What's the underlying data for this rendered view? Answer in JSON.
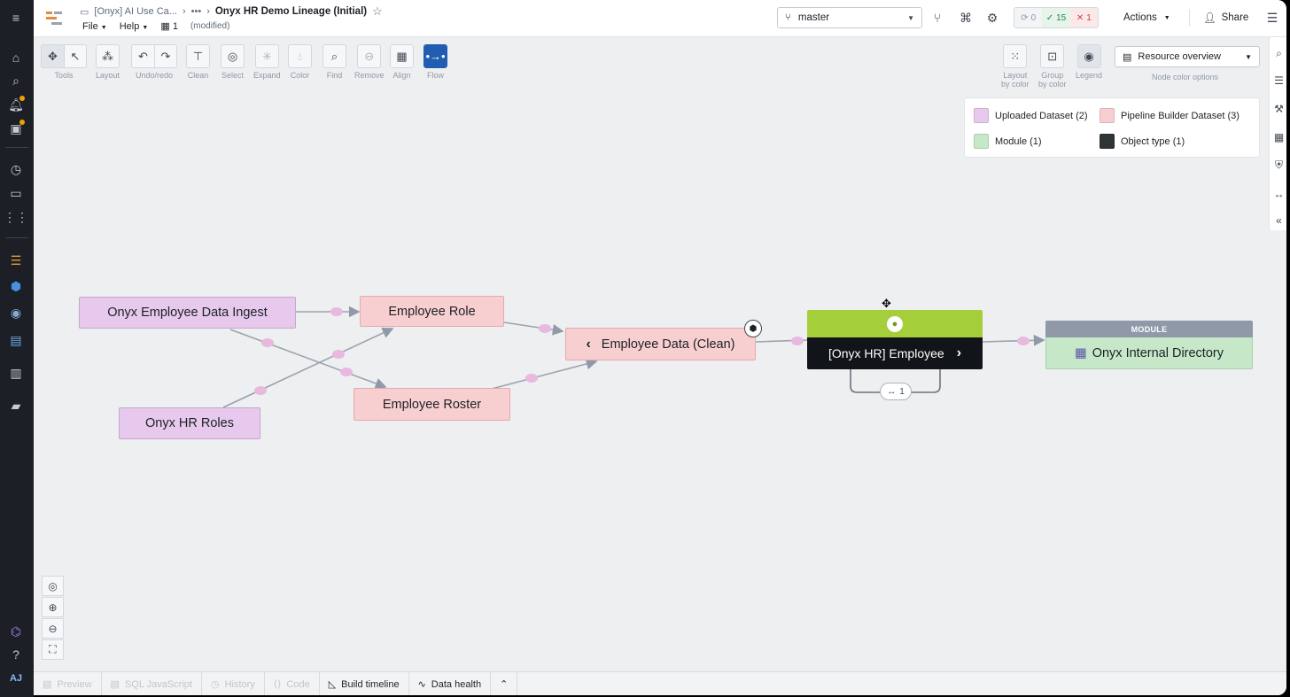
{
  "header": {
    "breadcrumb_parent": "[Onyx] AI Use Ca...",
    "breadcrumb_ellipsis": "•••",
    "title": "Onyx HR Demo Lineage (Initial)",
    "menu_file": "File",
    "menu_help": "Help",
    "branch_count": "1",
    "modified": "(modified)",
    "branch": "master",
    "checks_pending": "0",
    "checks_passed": "15",
    "checks_failed": "1",
    "actions_label": "Actions",
    "share_label": "Share"
  },
  "toolbar": {
    "tools": "Tools",
    "layout": "Layout",
    "undo_redo": "Undo/redo",
    "clean": "Clean",
    "select": "Select",
    "expand": "Expand",
    "color": "Color",
    "find": "Find",
    "remove": "Remove",
    "align": "Align",
    "flow": "Flow",
    "layout_by_color": "Layout",
    "layout_by_color_2": "by color",
    "group_by_color": "Group",
    "group_by_color_2": "by color",
    "legend": "Legend",
    "node_color_value": "Resource overview",
    "node_color_label": "Node color options"
  },
  "legend": {
    "items": [
      {
        "label": "Uploaded Dataset (2)",
        "color": "#e6c9ec"
      },
      {
        "label": "Pipeline Builder Dataset (3)",
        "color": "#f8cfd0"
      },
      {
        "label": "Module (1)",
        "color": "#c6e8c8"
      },
      {
        "label": "Object type (1)",
        "color": "#2f3437"
      }
    ]
  },
  "graph": {
    "nodes": {
      "ingest": "Onyx Employee Data Ingest",
      "roles": "Onyx HR Roles",
      "role": "Employee Role",
      "roster": "Employee Roster",
      "clean": "Employee Data (Clean)",
      "object_type": "[Onyx HR] Employee",
      "module_header": "MODULE",
      "module": "Onyx Internal Directory"
    },
    "link_count": "1"
  },
  "bottom": {
    "preview": "Preview",
    "sql": "SQL JavaScript",
    "history": "History",
    "code": "Code",
    "build_timeline": "Build timeline",
    "data_health": "Data health"
  },
  "rail": {
    "user_initials": "AJ"
  },
  "colors": {
    "uploaded": "#e6c9ec",
    "pipeline": "#f8cfd0",
    "module": "#c6e8c8",
    "object_top": "#a4cf3b",
    "object_bottom": "#111418",
    "flow_active": "#215db0"
  }
}
